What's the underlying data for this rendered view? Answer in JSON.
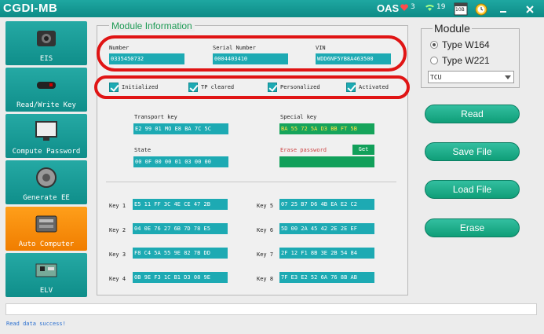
{
  "app": {
    "title": "CGDI-MB",
    "brand": "OAS",
    "hearts": "3",
    "signal": "19",
    "date": "10B"
  },
  "sidebar": {
    "items": [
      {
        "label": "EIS",
        "icon": "eis-module-icon"
      },
      {
        "label": "Read/Write Key",
        "icon": "car-key-icon"
      },
      {
        "label": "Compute Password",
        "icon": "monitor-icon"
      },
      {
        "label": "Generate EE",
        "icon": "steering-lock-icon"
      },
      {
        "label": "Auto Computer",
        "icon": "ecu-icon"
      },
      {
        "label": "ELV",
        "icon": "elv-board-icon"
      }
    ],
    "active_index": 4
  },
  "module_info": {
    "title": "Module Information",
    "number_label": "Number",
    "number_value": "0335450732",
    "serial_label": "Serial Number",
    "serial_value": "0004403410",
    "vin_label": "VIN",
    "vin_value": "WDD6NF5YB8A463500",
    "checks": [
      {
        "label": "Initialized",
        "checked": true
      },
      {
        "label": "TP cleared",
        "checked": true
      },
      {
        "label": "Personalized",
        "checked": true
      },
      {
        "label": "Activated",
        "checked": true
      }
    ],
    "transport_label": "Transport key",
    "transport_value": "E2 99 01 MO E8 BA 7C 5C",
    "special_label": "Special key",
    "special_value": "BA 55 72 5A D3 BB FT 5B",
    "state_label": "State",
    "state_value": "00 0F 00 00 01 03 00 00",
    "erase_label": "Erase password",
    "get_label": "Get",
    "erase_value": ""
  },
  "keys": [
    {
      "label": "Key 1",
      "value": "E5 11 FF 3C 4E CE 47 2B"
    },
    {
      "label": "Key 2",
      "value": "04 0E 76 27 6B 7D 78 E5"
    },
    {
      "label": "Key 3",
      "value": "F8 C4 5A 55 9E 82 7B DD"
    },
    {
      "label": "Key 4",
      "value": "0B 9E F3 1C B1 D3 08 9E"
    },
    {
      "label": "Key 5",
      "value": "07 25 B7 D6 4B EA E2 C2"
    },
    {
      "label": "Key 6",
      "value": "5D 00 2A 45 42 2E 2E EF"
    },
    {
      "label": "Key 7",
      "value": "2F 12 F1 8B 3E 2B 54 84"
    },
    {
      "label": "Key 8",
      "value": "7F E3 E2 52 6A 76 8B AB"
    }
  ],
  "module_select": {
    "title": "Module",
    "options": [
      {
        "label": "Type W164",
        "selected": true
      },
      {
        "label": "Type W221",
        "selected": false
      }
    ],
    "dropdown_value": "TCU"
  },
  "actions": {
    "read": "Read",
    "save": "Save File",
    "load": "Load File",
    "erase": "Erase"
  },
  "status": {
    "message": "Read data success!"
  },
  "colors": {
    "teal": "#1daab3",
    "orange": "#f7900f",
    "green": "#16a45b",
    "highlight": "#e01414"
  }
}
